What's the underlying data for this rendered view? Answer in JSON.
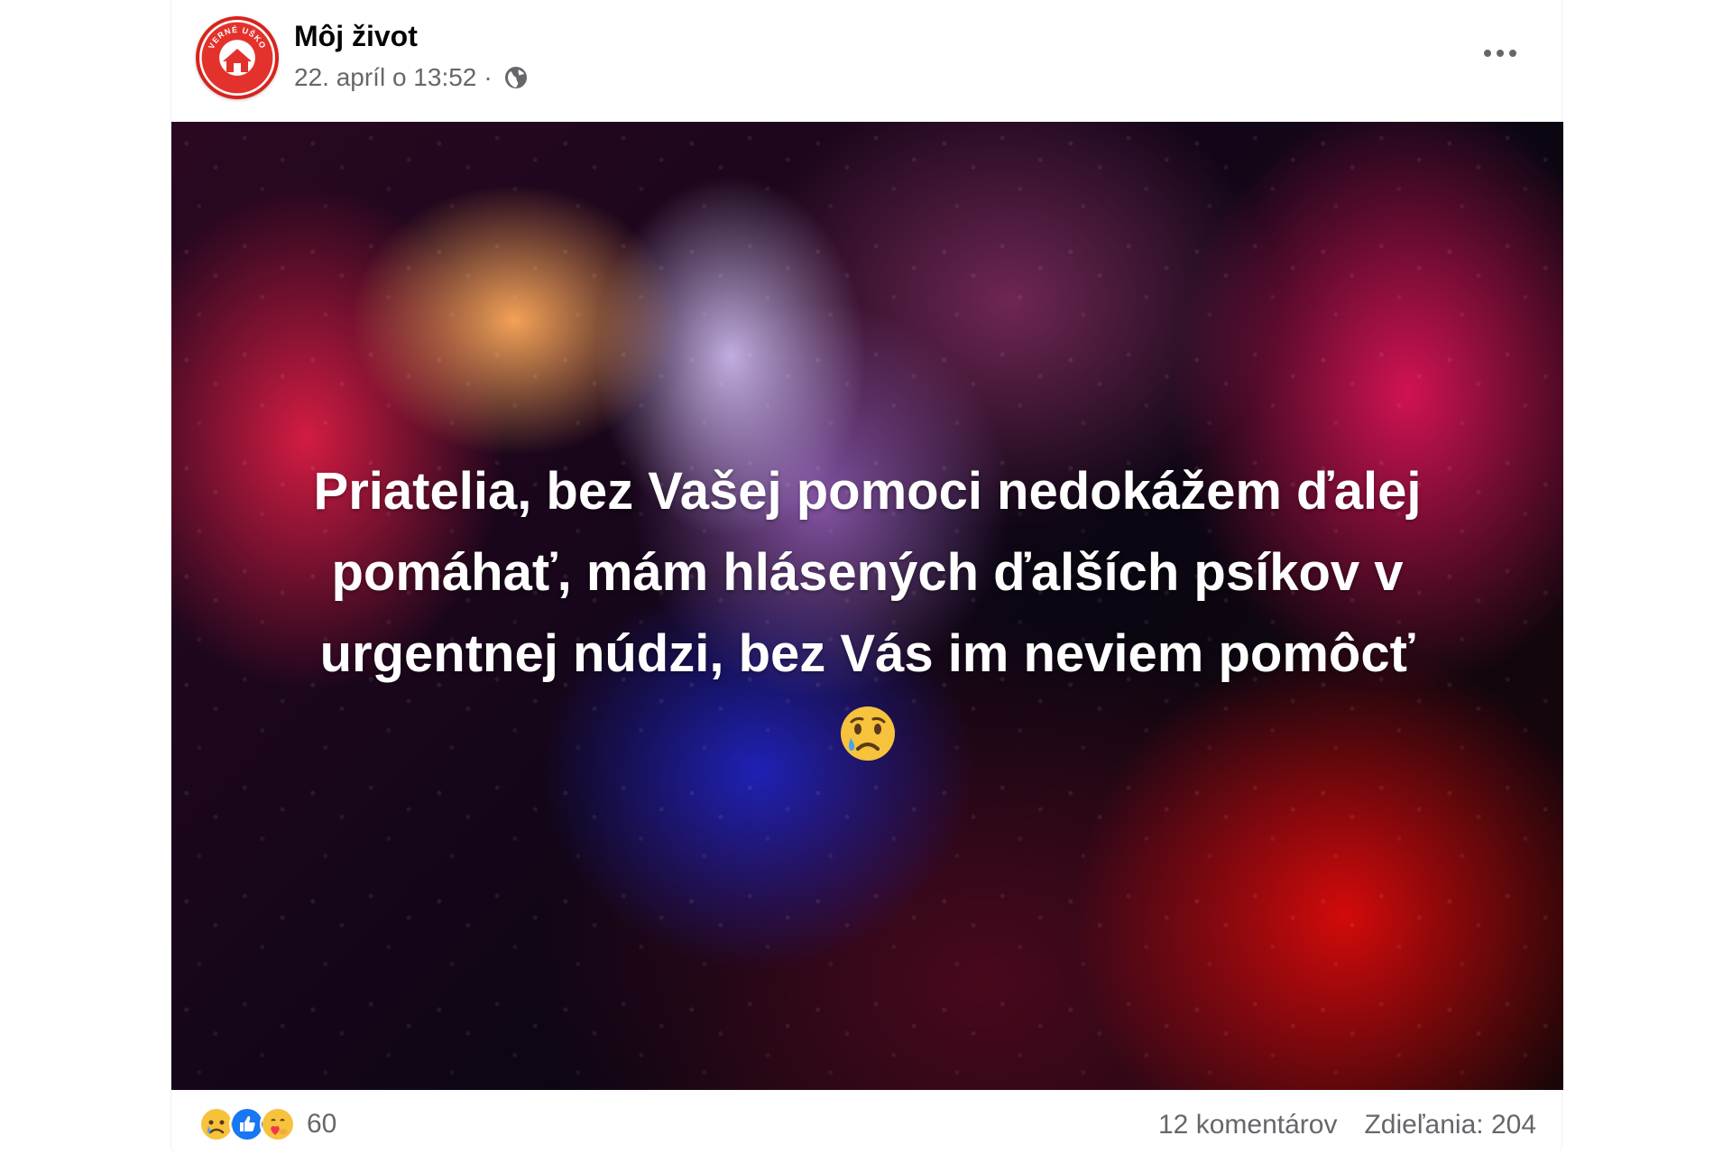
{
  "post": {
    "page_name": "Môj život",
    "date": "22. apríl o 13:52",
    "separator": "·",
    "avatar_text": "VERNÉ UŠKO",
    "text_line1": "Priatelia, bez Vašej pomoci nedokážem ďalej",
    "text_line2": "pomáhať, mám hlásených ďalších psíkov v",
    "text_line3": "urgentnej núdzi, bez Vás im neviem pomôcť"
  },
  "footer": {
    "reactions": [
      "sad-reaction",
      "like-reaction",
      "care-reaction"
    ],
    "reaction_count": "60",
    "comments": "12 komentárov",
    "shares": "Zdieľania: 204"
  },
  "colors": {
    "brand_red": "#e3322b",
    "like_blue": "#1877f2",
    "muted_text": "#65676b"
  }
}
